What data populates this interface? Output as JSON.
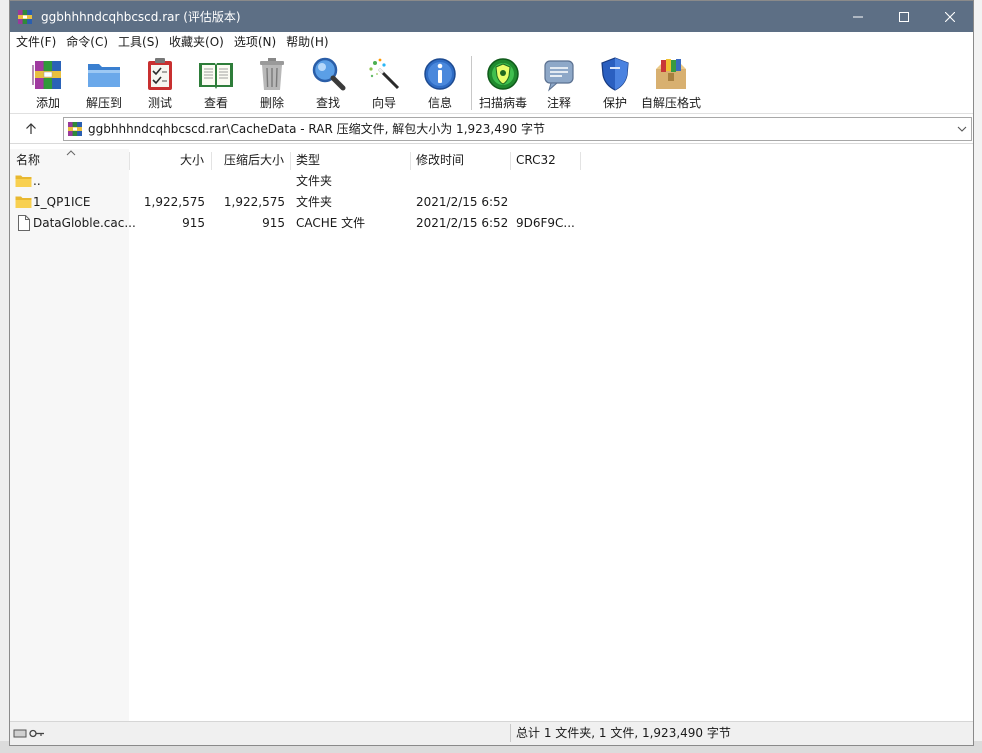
{
  "window": {
    "title": "ggbhhhndcqhbcscd.rar (评估版本)",
    "accent_color": "#5d6f85"
  },
  "menu": [
    "文件(F)",
    "命令(C)",
    "工具(S)",
    "收藏夹(O)",
    "选项(N)",
    "帮助(H)"
  ],
  "toolbar": {
    "tools": [
      {
        "label": "添加",
        "icon": "add-archive-icon"
      },
      {
        "label": "解压到",
        "icon": "extract-folder-icon"
      },
      {
        "label": "测试",
        "icon": "test-clipboard-icon"
      },
      {
        "label": "查看",
        "icon": "view-book-icon"
      },
      {
        "label": "删除",
        "icon": "trash-icon"
      },
      {
        "label": "查找",
        "icon": "magnifier-icon"
      },
      {
        "label": "向导",
        "icon": "wizard-wand-icon"
      },
      {
        "label": "信息",
        "icon": "info-icon"
      },
      {
        "label": "扫描病毒",
        "icon": "virus-scan-icon"
      },
      {
        "label": "注释",
        "icon": "comment-icon"
      },
      {
        "label": "保护",
        "icon": "shield-icon"
      },
      {
        "label": "自解压格式",
        "icon": "sfx-box-icon"
      }
    ]
  },
  "address": {
    "path": "ggbhhhndcqhbcscd.rar\\CacheData - RAR 压缩文件, 解包大小为 1,923,490 字节"
  },
  "columns": [
    "名称",
    "大小",
    "压缩后大小",
    "类型",
    "修改时间",
    "CRC32"
  ],
  "files": [
    {
      "name": "..",
      "size": "",
      "packed": "",
      "type": "文件夹",
      "modified": "",
      "crc": "",
      "icon": "folder-icon"
    },
    {
      "name": "1_QP1ICE",
      "size": "1,922,575",
      "packed": "1,922,575",
      "type": "文件夹",
      "modified": "2021/2/15 6:52",
      "crc": "",
      "icon": "folder-icon"
    },
    {
      "name": "DataGloble.cac...",
      "size": "915",
      "packed": "915",
      "type": "CACHE 文件",
      "modified": "2021/2/15 6:52",
      "crc": "9D6F9C...",
      "icon": "file-icon"
    }
  ],
  "status": {
    "text": "总计 1 文件夹, 1 文件, 1,923,490 字节"
  }
}
